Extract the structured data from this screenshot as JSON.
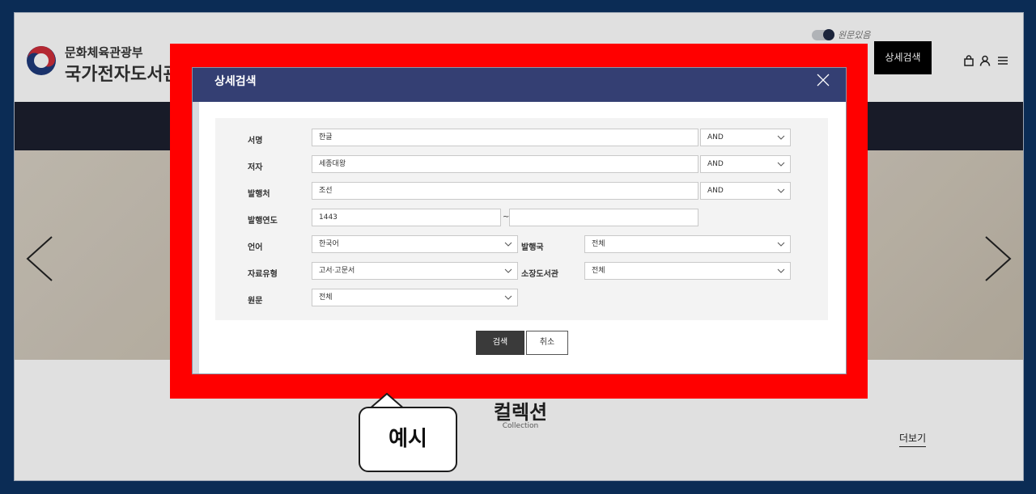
{
  "header": {
    "ministry_name": "문화체육관광부",
    "library_name": "국가전자도서관",
    "original_toggle_label": "원문있음",
    "advanced_search_button": "상세검색"
  },
  "collection": {
    "title": "컬렉션",
    "subtitle": "Collection",
    "more_link": "더보기"
  },
  "modal": {
    "title": "상세검색",
    "fields": {
      "title_label": "서명",
      "title_value": "한글",
      "title_operator": "AND",
      "author_label": "저자",
      "author_value": "세종대왕",
      "author_operator": "AND",
      "publisher_label": "발행처",
      "publisher_value": "조선",
      "publisher_operator": "AND",
      "year_label": "발행연도",
      "year_from": "1443",
      "year_to": "",
      "year_separator": "~",
      "language_label": "언어",
      "language_value": "한국어",
      "country_label": "발행국",
      "country_value": "전체",
      "type_label": "자료유형",
      "type_value": "고서·고문서",
      "holding_label": "소장도서관",
      "holding_value": "전체",
      "original_label": "원문",
      "original_value": "전체"
    },
    "search_button": "검색",
    "cancel_button": "취소"
  },
  "callout": {
    "text": "예시"
  },
  "colors": {
    "modal_header": "#343f73",
    "highlight": "#ff0000",
    "outer_background": "#0b2c55"
  }
}
